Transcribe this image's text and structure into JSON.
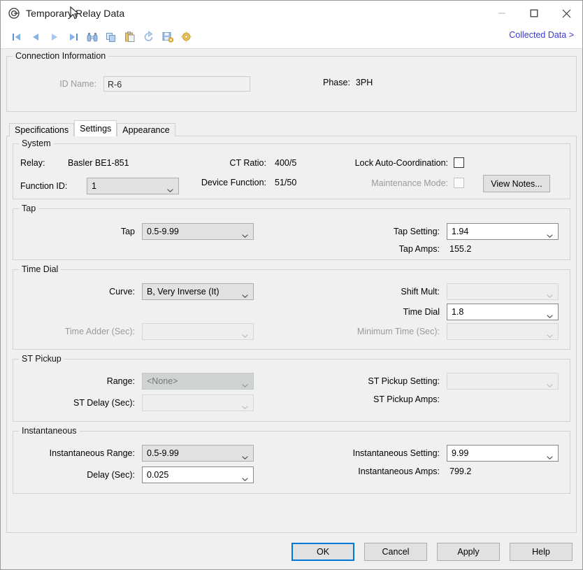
{
  "window": {
    "title": "Temporary Relay Data",
    "icon": "relay-icon",
    "minimize": "–",
    "maximize": "☐",
    "close": "✕"
  },
  "toolbar": {
    "icons": [
      {
        "name": "first-record-icon",
        "title": "First"
      },
      {
        "name": "previous-record-icon",
        "title": "Previous"
      },
      {
        "name": "next-record-icon",
        "title": "Next"
      },
      {
        "name": "last-record-icon",
        "title": "Last"
      },
      {
        "name": "find-binoculars-icon",
        "title": "Find"
      },
      {
        "name": "copy-icon",
        "title": "Copy"
      },
      {
        "name": "paste-icon",
        "title": "Paste"
      },
      {
        "name": "refresh-undo-icon",
        "title": "Refresh"
      },
      {
        "name": "save-settings-icon",
        "title": "Save Settings"
      },
      {
        "name": "gear-settings-icon",
        "title": "Settings"
      }
    ],
    "collected_data_link": "Collected Data >"
  },
  "connection": {
    "legend": "Connection Information",
    "id_name_label": "ID Name:",
    "id_name_value": "R-6",
    "phase_label": "Phase:",
    "phase_value": "3PH"
  },
  "tabs": [
    {
      "label": "Specifications",
      "active": false
    },
    {
      "label": "Settings",
      "active": true
    },
    {
      "label": "Appearance",
      "active": false
    }
  ],
  "system": {
    "legend": "System",
    "relay_label": "Relay:",
    "relay_value": "Basler BE1-851",
    "function_id_label": "Function ID:",
    "function_id_value": "1",
    "ct_ratio_label": "CT Ratio:",
    "ct_ratio_value": "400/5",
    "device_function_label": "Device Function:",
    "device_function_value": "51/50",
    "lock_auto_coordination_label": "Lock Auto-Coordination:",
    "lock_auto_coordination_checked": false,
    "maintenance_mode_label": "Maintenance Mode:",
    "maintenance_mode_checked": false,
    "view_notes_button": "View Notes..."
  },
  "tap": {
    "legend": "Tap",
    "tap_label": "Tap",
    "tap_value": "0.5-9.99",
    "tap_setting_label": "Tap Setting:",
    "tap_setting_value": "1.94",
    "tap_amps_label": "Tap Amps:",
    "tap_amps_value": "155.2"
  },
  "time_dial": {
    "legend": "Time Dial",
    "curve_label": "Curve:",
    "curve_value": "B, Very Inverse (It)",
    "time_adder_label": "Time Adder (Sec):",
    "time_adder_value": "",
    "shift_mult_label": "Shift Mult:",
    "shift_mult_value": "",
    "time_dial_label": "Time Dial",
    "time_dial_value": "1.8",
    "minimum_time_label": "Minimum Time (Sec):",
    "minimum_time_value": ""
  },
  "st_pickup": {
    "legend": "ST Pickup",
    "range_label": "Range:",
    "range_value": "<None>",
    "st_delay_label": "ST Delay (Sec):",
    "st_delay_value": "",
    "st_pickup_setting_label": "ST Pickup Setting:",
    "st_pickup_setting_value": "",
    "st_pickup_amps_label": "ST Pickup Amps:",
    "st_pickup_amps_value": ""
  },
  "instantaneous": {
    "legend": "Instantaneous",
    "range_label": "Instantaneous Range:",
    "range_value": "0.5-9.99",
    "delay_label": "Delay (Sec):",
    "delay_value": "0.025",
    "setting_label": "Instantaneous Setting:",
    "setting_value": "9.99",
    "amps_label": "Instantaneous Amps:",
    "amps_value": "799.2"
  },
  "footer": {
    "ok": "OK",
    "cancel": "Cancel",
    "apply": "Apply",
    "help": "Help"
  },
  "colors": {
    "link": "#3a3ad0",
    "focus": "#0078d7",
    "dialog_bg": "#f0f0f0"
  }
}
